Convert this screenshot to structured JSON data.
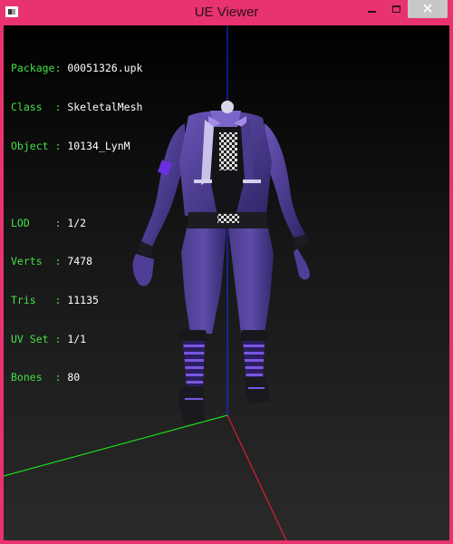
{
  "window": {
    "title": "UE Viewer",
    "frame_color": "#e8336f",
    "controls": {
      "minimize_icon": "minimize-icon",
      "maximize_icon": "maximize-icon",
      "close_icon": "close-icon",
      "close_glyph": "✕"
    }
  },
  "overlay": {
    "label_color": "#43e046",
    "value_color": "#ffffff",
    "info": [
      {
        "label": "Package:",
        "value": "00051326.upk"
      },
      {
        "label": "Class  :",
        "value": "SkeletalMesh"
      },
      {
        "label": "Object :",
        "value": "10134_LynM"
      }
    ],
    "stats": [
      {
        "label": "LOD    :",
        "value": "1/2"
      },
      {
        "label": "Verts  :",
        "value": "7478"
      },
      {
        "label": "Tris   :",
        "value": "11135"
      },
      {
        "label": "UV Set :",
        "value": "1/1"
      },
      {
        "label": "Bones  :",
        "value": "80"
      }
    ]
  },
  "scene": {
    "axis_colors": {
      "x": "#ff1a3a",
      "y": "#1aff1a",
      "z": "#1a2cff"
    },
    "model": "headless purple and black skeletal mesh outfit (jacket, checkered vest, trousers, boots)"
  }
}
